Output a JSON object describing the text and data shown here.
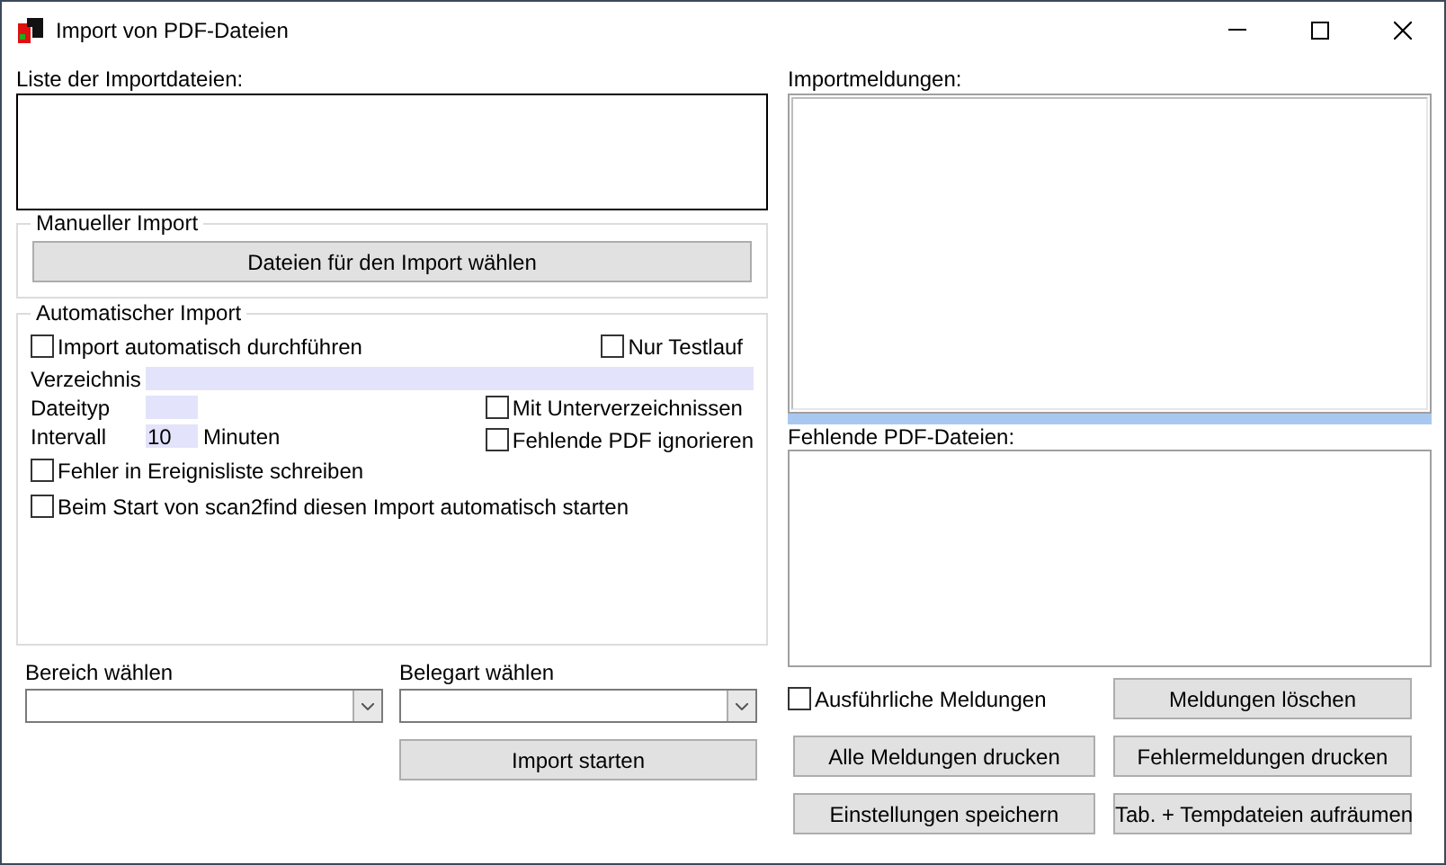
{
  "window": {
    "title": "Import von PDF-Dateien"
  },
  "import_list": {
    "label": "Liste der Importdateien:"
  },
  "manual_import": {
    "title": "Manueller Import",
    "button": "Dateien für den Import wählen"
  },
  "auto_import": {
    "title": "Automatischer Import",
    "auto_run": {
      "label": "Import automatisch durchführen",
      "checked": false
    },
    "test_run": {
      "label": "Nur Testlauf",
      "checked": false
    },
    "directory": {
      "label": "Verzeichnis"
    },
    "file_type": {
      "label": "Dateityp"
    },
    "interval": {
      "label": "Intervall",
      "value": "10",
      "unit": "Minuten"
    },
    "subdirectories": {
      "label": "Mit Unterverzeichnissen",
      "checked": false
    },
    "ignore_missing": {
      "label": "Fehlende PDF ignorieren",
      "checked": false
    },
    "log_errors": {
      "label": "Fehler in Ereignisliste schreiben",
      "checked": false
    },
    "autostart": {
      "label": "Beim Start von scan2find diesen Import automatisch starten",
      "checked": false
    }
  },
  "area_select": {
    "label": "Bereich wählen"
  },
  "doc_type_select": {
    "label": "Belegart wählen"
  },
  "start_button": "Import starten",
  "messages": {
    "label": "Importmeldungen:"
  },
  "missing_files": {
    "label": "Fehlende PDF-Dateien:"
  },
  "verbose": {
    "label": "Ausführliche Meldungen",
    "checked": false
  },
  "buttons": [
    "Meldungen löschen",
    "Alle Meldungen drucken",
    "Fehlermeldungen drucken",
    "Einstellungen speichern",
    "Tab. + Tempdateien aufräumen"
  ]
}
